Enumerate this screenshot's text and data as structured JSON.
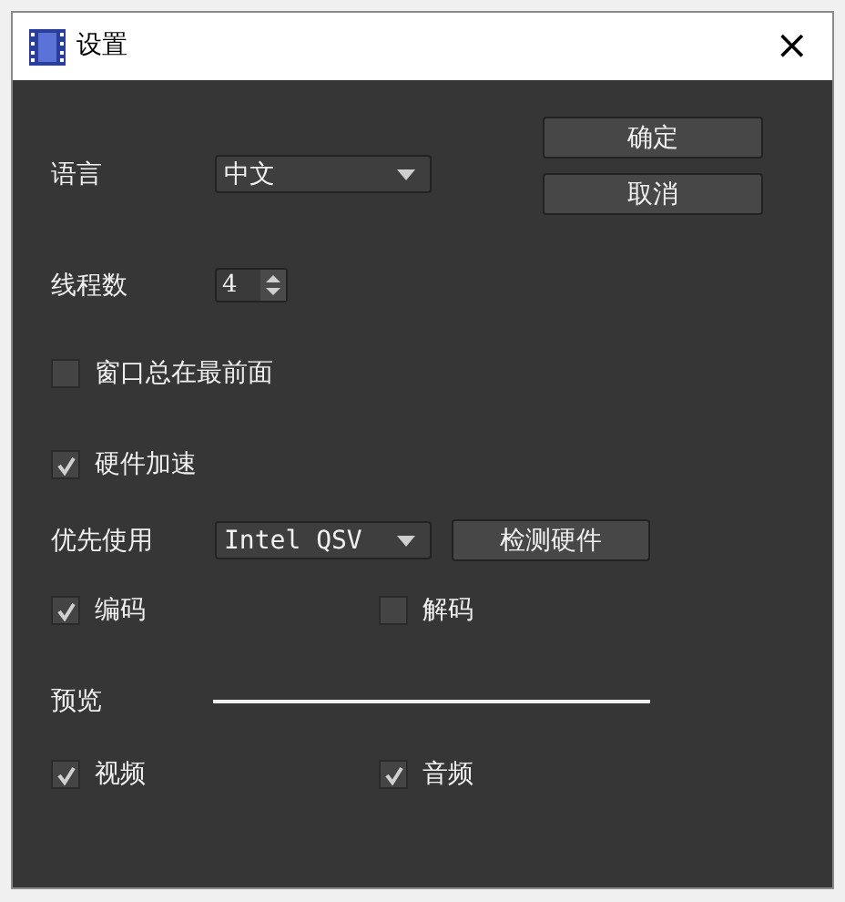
{
  "window": {
    "title": "设置",
    "close": "×"
  },
  "language": {
    "label": "语言",
    "value": "中文"
  },
  "buttons": [
    "确定",
    "取消"
  ],
  "threads": {
    "label": "线程数",
    "value": "4"
  },
  "always_on_top": {
    "label": "窗口总在最前面",
    "checked": false
  },
  "hardware_acceleration": {
    "label": "硬件加速",
    "checked": true
  },
  "preferred": {
    "label": "优先使用",
    "value": "Intel QSV",
    "button": "检测硬件"
  },
  "codec_options": [
    {
      "label": "编码",
      "checked": true
    },
    {
      "label": "解码",
      "checked": false
    }
  ],
  "preview": {
    "label": "预览"
  },
  "preview_options": [
    {
      "label": "视频",
      "checked": true
    },
    {
      "label": "音频",
      "checked": true
    }
  ]
}
